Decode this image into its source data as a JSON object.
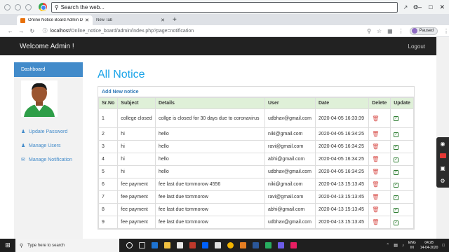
{
  "browser": {
    "search_placeholder": "Search the web...",
    "tabs": [
      {
        "title": "Online Notice Board Admin Das",
        "active": true
      },
      {
        "title": "New Tab",
        "active": false
      }
    ],
    "address_host": "localhost",
    "address_path": "/Online_notice_board/admin/index.php?page=notification",
    "profile_status": "Paused"
  },
  "page": {
    "brand": "Welcome Admin !",
    "logout": "Logout",
    "sidebar": {
      "active": "Dashboard",
      "links": [
        {
          "label": "Update Password",
          "icon": "user-icon"
        },
        {
          "label": "Manage Users",
          "icon": "user-icon"
        },
        {
          "label": "Manage Notification",
          "icon": "envelope-icon"
        }
      ]
    },
    "title": "All Notice",
    "add_new": "Add New notice",
    "table": {
      "headers": [
        "Sr.No",
        "Subject",
        "Details",
        "User",
        "Date",
        "Delete",
        "Update"
      ],
      "rows": [
        [
          "1",
          "college closed",
          "collge is closed for 30 days due to coronavirus",
          "udbhav@gmail.com",
          "2020-04-05 16:33:39"
        ],
        [
          "2",
          "hi",
          "hello",
          "niki@gmail.com",
          "2020-04-05 16:34:25"
        ],
        [
          "3",
          "hi",
          "hello",
          "ravi@gmail.com",
          "2020-04-05 16:34:25"
        ],
        [
          "4",
          "hi",
          "hello",
          "abhi@gmail.com",
          "2020-04-05 16:34:25"
        ],
        [
          "5",
          "hi",
          "hello",
          "udbhav@gmail.com",
          "2020-04-05 16:34:25"
        ],
        [
          "6",
          "fee payment",
          "fee last due tommorow 4556",
          "niki@gmail.com",
          "2020-04-13 15:13:45"
        ],
        [
          "7",
          "fee payment",
          "fee last due tommorow",
          "ravi@gmail.com",
          "2020-04-13 15:13:45"
        ],
        [
          "8",
          "fee payment",
          "fee last due tommorow",
          "abhi@gmail.com",
          "2020-04-13 15:13:45"
        ],
        [
          "9",
          "fee payment",
          "fee last due tommorow",
          "udbhav@gmail.com",
          "2020-04-13 15:13:45"
        ]
      ]
    }
  },
  "taskbar": {
    "search_placeholder": "Type here to search",
    "lang": "ENG",
    "region": "IN",
    "time": "04:28",
    "date": "14-04-2020"
  },
  "colors": {
    "navbar": "#222222",
    "accent": "#428bca",
    "title": "#18a3e8",
    "table_head": "#dff0d8"
  }
}
